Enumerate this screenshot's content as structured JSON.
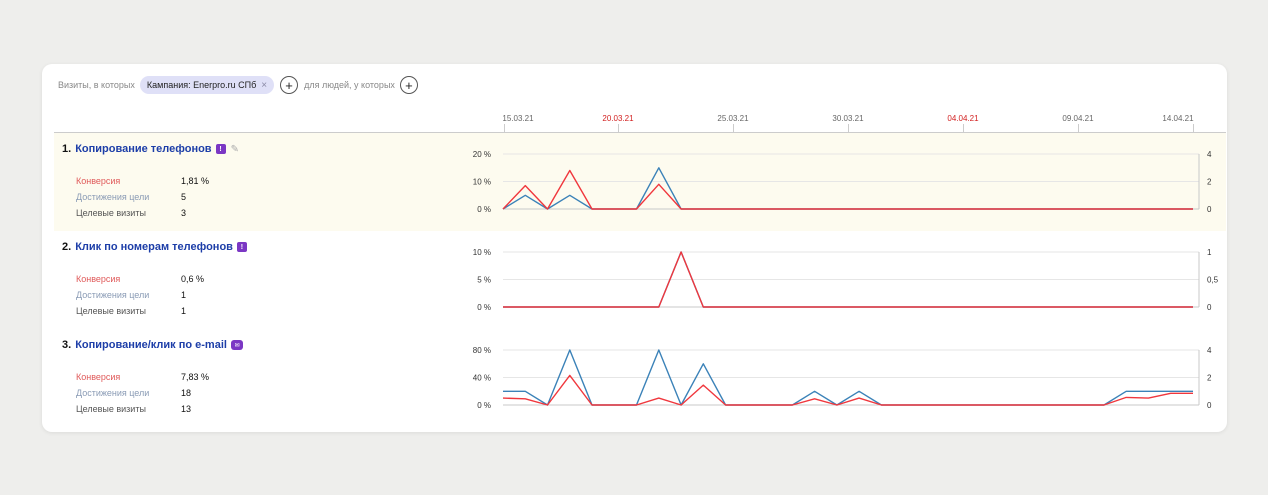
{
  "filter": {
    "prefix": "Визиты, в которых",
    "chip_label": "Кампания: Enerpro.ru СПб",
    "chip_close": "×",
    "plus": "+",
    "middle": "для людей, у которых"
  },
  "timeline": {
    "dates": [
      {
        "label": "15.03.21",
        "red": false
      },
      {
        "label": "20.03.21",
        "red": true
      },
      {
        "label": "25.03.21",
        "red": false
      },
      {
        "label": "30.03.21",
        "red": false
      },
      {
        "label": "04.04.21",
        "red": true
      },
      {
        "label": "09.04.21",
        "red": false
      },
      {
        "label": "14.04.21",
        "red": false
      }
    ]
  },
  "colors": {
    "conversion": "#f0373d",
    "reaches": "#3b82b8",
    "weekend": "#d21f1f",
    "highlight": "#fdfbef"
  },
  "goals": [
    {
      "num": "1.",
      "title": "Копирование телефонов",
      "badge": "!",
      "editable": true,
      "metrics": [
        {
          "label": "Конверсия",
          "value": "1,81 %"
        },
        {
          "label": "Достижения цели",
          "value": "5"
        },
        {
          "label": "Целевые визиты",
          "value": "3"
        }
      ]
    },
    {
      "num": "2.",
      "title": "Клик по номерам телефонов",
      "badge": "!",
      "editable": false,
      "metrics": [
        {
          "label": "Конверсия",
          "value": "0,6 %"
        },
        {
          "label": "Достижения цели",
          "value": "1"
        },
        {
          "label": "Целевые визиты",
          "value": "1"
        }
      ]
    },
    {
      "num": "3.",
      "title": "Копирование/клик по e-mail",
      "badge": "✉",
      "editable": false,
      "metrics": [
        {
          "label": "Конверсия",
          "value": "7,83 %"
        },
        {
          "label": "Достижения цели",
          "value": "18"
        },
        {
          "label": "Целевые визиты",
          "value": "13"
        }
      ]
    }
  ],
  "chart_data": [
    {
      "type": "line",
      "x": [
        "15.03.21",
        "16.03.21",
        "17.03.21",
        "18.03.21",
        "19.03.21",
        "20.03.21",
        "21.03.21",
        "22.03.21",
        "23.03.21",
        "24.03.21",
        "25.03.21",
        "26.03.21",
        "27.03.21",
        "28.03.21",
        "29.03.21",
        "30.03.21",
        "31.03.21",
        "01.04.21",
        "02.04.21",
        "03.04.21",
        "04.04.21",
        "05.04.21",
        "06.04.21",
        "07.04.21",
        "08.04.21",
        "09.04.21",
        "10.04.21",
        "11.04.21",
        "12.04.21",
        "13.04.21",
        "14.04.21",
        "15.04.21"
      ],
      "left_axis": {
        "ticks": [
          "0 %",
          "10 %",
          "20 %"
        ],
        "range": [
          0,
          20
        ]
      },
      "right_axis": {
        "ticks": [
          "0",
          "2",
          "4"
        ],
        "range": [
          0,
          4
        ]
      },
      "series": [
        {
          "name": "Конверсия",
          "axis": "left",
          "values": [
            0,
            8.5,
            0,
            14,
            0,
            0,
            0,
            9,
            0,
            0,
            0,
            0,
            0,
            0,
            0,
            0,
            0,
            0,
            0,
            0,
            0,
            0,
            0,
            0,
            0,
            0,
            0,
            0,
            0,
            0,
            0,
            0
          ]
        },
        {
          "name": "Достижения цели",
          "axis": "right",
          "values": [
            0,
            1,
            0,
            1,
            0,
            0,
            0,
            3,
            0,
            0,
            0,
            0,
            0,
            0,
            0,
            0,
            0,
            0,
            0,
            0,
            0,
            0,
            0,
            0,
            0,
            0,
            0,
            0,
            0,
            0,
            0,
            0
          ]
        }
      ]
    },
    {
      "type": "line",
      "x": [
        "15.03.21",
        "16.03.21",
        "17.03.21",
        "18.03.21",
        "19.03.21",
        "20.03.21",
        "21.03.21",
        "22.03.21",
        "23.03.21",
        "24.03.21",
        "25.03.21",
        "26.03.21",
        "27.03.21",
        "28.03.21",
        "29.03.21",
        "30.03.21",
        "31.03.21",
        "01.04.21",
        "02.04.21",
        "03.04.21",
        "04.04.21",
        "05.04.21",
        "06.04.21",
        "07.04.21",
        "08.04.21",
        "09.04.21",
        "10.04.21",
        "11.04.21",
        "12.04.21",
        "13.04.21",
        "14.04.21",
        "15.04.21"
      ],
      "left_axis": {
        "ticks": [
          "0 %",
          "5 %",
          "10 %"
        ],
        "range": [
          0,
          10
        ]
      },
      "right_axis": {
        "ticks": [
          "0",
          "0,5",
          "1"
        ],
        "range": [
          0,
          1
        ]
      },
      "series": [
        {
          "name": "Конверсия",
          "axis": "left",
          "values": [
            0,
            0,
            0,
            0,
            0,
            0,
            0,
            0,
            10,
            0,
            0,
            0,
            0,
            0,
            0,
            0,
            0,
            0,
            0,
            0,
            0,
            0,
            0,
            0,
            0,
            0,
            0,
            0,
            0,
            0,
            0,
            0
          ]
        },
        {
          "name": "Достижения цели",
          "axis": "right",
          "values": [
            0,
            0,
            0,
            0,
            0,
            0,
            0,
            0,
            1,
            0,
            0,
            0,
            0,
            0,
            0,
            0,
            0,
            0,
            0,
            0,
            0,
            0,
            0,
            0,
            0,
            0,
            0,
            0,
            0,
            0,
            0,
            0
          ]
        }
      ]
    },
    {
      "type": "line",
      "x": [
        "15.03.21",
        "16.03.21",
        "17.03.21",
        "18.03.21",
        "19.03.21",
        "20.03.21",
        "21.03.21",
        "22.03.21",
        "23.03.21",
        "24.03.21",
        "25.03.21",
        "26.03.21",
        "27.03.21",
        "28.03.21",
        "29.03.21",
        "30.03.21",
        "31.03.21",
        "01.04.21",
        "02.04.21",
        "03.04.21",
        "04.04.21",
        "05.04.21",
        "06.04.21",
        "07.04.21",
        "08.04.21",
        "09.04.21",
        "10.04.21",
        "11.04.21",
        "12.04.21",
        "13.04.21",
        "14.04.21",
        "15.04.21"
      ],
      "left_axis": {
        "ticks": [
          "0 %",
          "40 %",
          "80 %"
        ],
        "range": [
          0,
          80
        ]
      },
      "right_axis": {
        "ticks": [
          "0",
          "2",
          "4"
        ],
        "range": [
          0,
          4
        ]
      },
      "series": [
        {
          "name": "Конверсия",
          "axis": "left",
          "values": [
            10,
            9,
            0,
            43,
            0,
            0,
            0,
            10,
            0,
            29,
            0,
            0,
            0,
            0,
            9,
            0,
            10,
            0,
            0,
            0,
            0,
            0,
            0,
            0,
            0,
            0,
            0,
            0,
            11,
            10,
            17,
            17
          ]
        },
        {
          "name": "Достижения цели",
          "axis": "right",
          "values": [
            1,
            1,
            0,
            4,
            0,
            0,
            0,
            4,
            0,
            3,
            0,
            0,
            0,
            0,
            1,
            0,
            1,
            0,
            0,
            0,
            0,
            0,
            0,
            0,
            0,
            0,
            0,
            0,
            1,
            1,
            1,
            1
          ]
        }
      ]
    }
  ]
}
